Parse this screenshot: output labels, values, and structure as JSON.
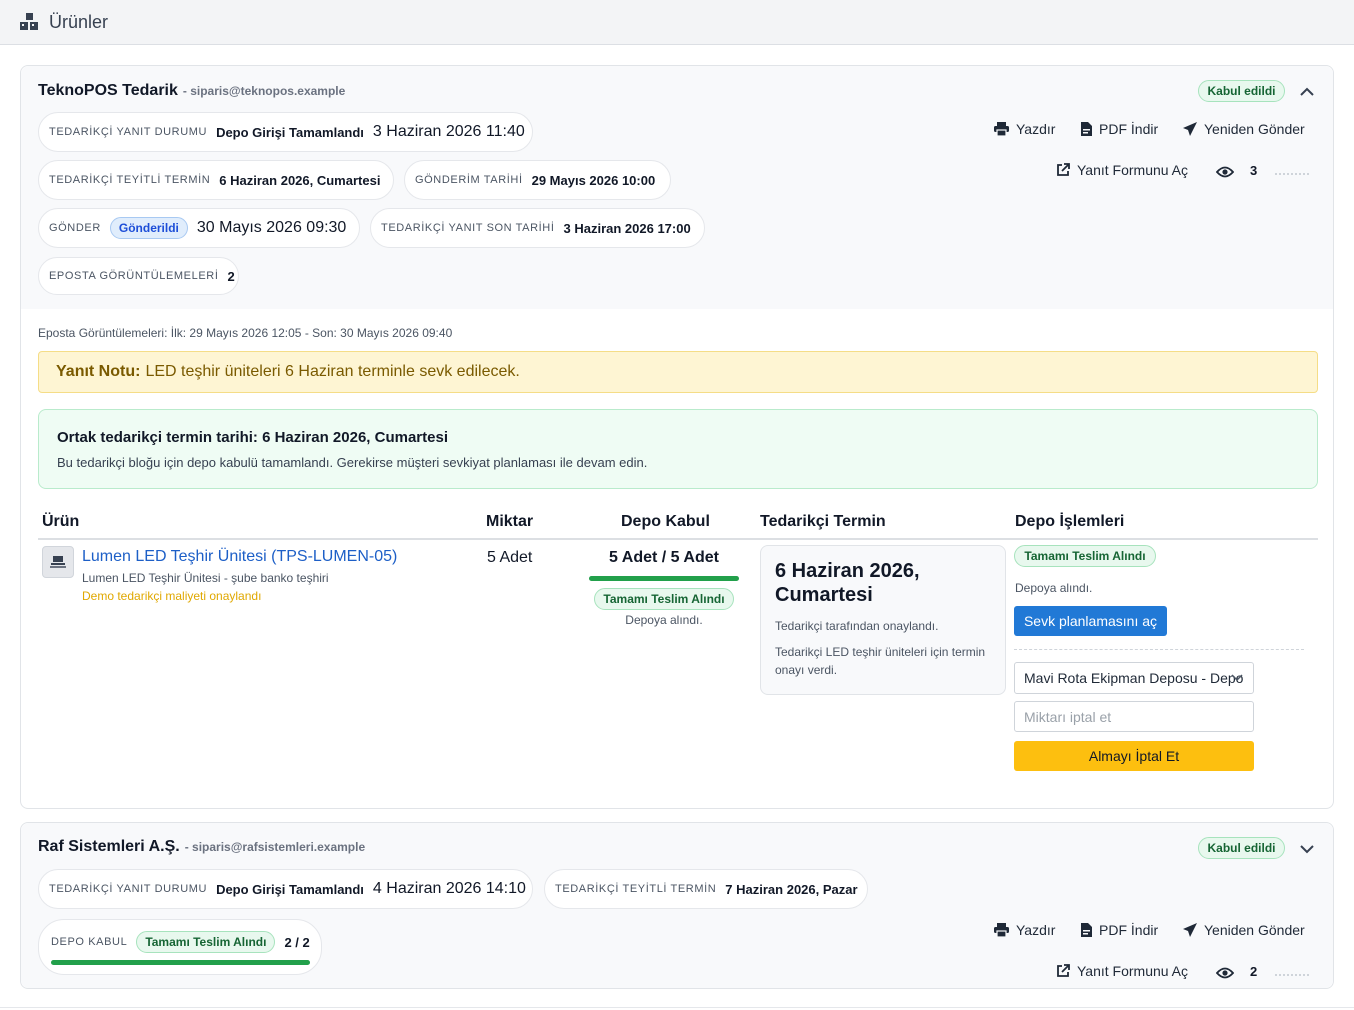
{
  "page": {
    "title": "Ürünler"
  },
  "suppliers": [
    {
      "name": "TeknoPOS Tedarik",
      "email": "- siparis@teknopos.example",
      "status": "Kabul edildi",
      "pills": {
        "response": {
          "label": "TEDARİKÇİ YANIT DURUMU",
          "value": "Depo Girişi Tamamlandı",
          "time": "3 Haziran 2026 11:40"
        },
        "confirmed": {
          "label": "TEDARİKÇİ TEYİTLİ TERMİN",
          "value": "6 Haziran 2026, Cumartesi"
        },
        "sent_date": {
          "label": "GÖNDERİM TARİHİ",
          "value": "29 Mayıs 2026 10:00"
        },
        "send": {
          "label": "GÖNDER",
          "badge": "Gönderildi",
          "time": "30 Mayıs 2026 09:30"
        },
        "deadline": {
          "label": "TEDARİKÇİ YANIT SON TARİHİ",
          "value": "3 Haziran 2026 17:00"
        },
        "email_views": {
          "label": "EPOSTA GÖRÜNTÜLEMELERİ",
          "value": "2"
        }
      },
      "actions": {
        "print": "Yazdır",
        "pdf": "PDF İndir",
        "resend": "Yeniden Gönder",
        "open_form": "Yanıt Formunu Aç",
        "views": "3"
      },
      "views_line": "Eposta Görüntülemeleri: İlk: 29 Mayıs 2026 12:05 - Son: 30 Mayıs 2026 09:40",
      "note": {
        "label": "Yanıt Notu:",
        "text": "LED teşhir üniteleri 6 Haziran terminle sevk edilecek."
      },
      "common_term": {
        "title": "Ortak tedarikçi termin tarihi: 6 Haziran 2026, Cumartesi",
        "text": "Bu tedarikçi bloğu için depo kabulü tamamlandı. Gerekirse müşteri sevkiyat planlaması ile devam edin."
      },
      "table": {
        "headers": {
          "product": "Ürün",
          "qty": "Miktar",
          "receive": "Depo Kabul",
          "term": "Tedarikçi Termin",
          "ops": "Depo İşlemleri"
        },
        "row": {
          "product_link": "Lumen LED Teşhir Ünitesi (TPS-LUMEN-05)",
          "product_sub": "Lumen LED Teşhir Ünitesi - şube banko teşhiri",
          "product_warn": "Demo tedarikçi maliyeti onaylandı",
          "qty": "5 Adet",
          "received": "5 Adet / 5 Adet",
          "received_fraction": 1.0,
          "received_badge": "Tamamı Teslim Alındı",
          "received_note": "Depoya alındı.",
          "term_date": "6 Haziran 2026, Cumartesi",
          "term_status": "Tedarikçi tarafından onaylandı.",
          "term_note": "Tedarikçi LED teşhir üniteleri için termin onayı verdi.",
          "ops_badge": "Tamamı Teslim Alındı",
          "ops_note": "Depoya alındı.",
          "ops_button": "Sevk planlamasını aç",
          "warehouse": "Mavi Rota Ekipman Deposu - Depo",
          "cancel_placeholder": "Miktarı iptal et",
          "cancel_button": "Almayı İptal Et"
        }
      }
    },
    {
      "name": "Raf Sistemleri A.Ş.",
      "email": "- siparis@rafsistemleri.example",
      "status": "Kabul edildi",
      "pills": {
        "response": {
          "label": "TEDARİKÇİ YANIT DURUMU",
          "value": "Depo Girişi Tamamlandı",
          "time": "4 Haziran 2026 14:10"
        },
        "confirmed": {
          "label": "TEDARİKÇİ TEYİTLİ TERMİN",
          "value": "7 Haziran 2026, Pazar"
        },
        "receive": {
          "label": "DEPO KABUL",
          "badge": "Tamamı Teslim Alındı",
          "value": "2 / 2",
          "fraction": 1.0
        }
      },
      "actions": {
        "print": "Yazdır",
        "pdf": "PDF İndir",
        "resend": "Yeniden Gönder",
        "open_form": "Yanıt Formunu Aç",
        "views": "2"
      }
    }
  ],
  "colors": {
    "accent_blue": "#2179d6",
    "warning_yellow": "#fdbf0f",
    "success_green": "#22a04b",
    "link_blue": "#1d5fc7"
  }
}
